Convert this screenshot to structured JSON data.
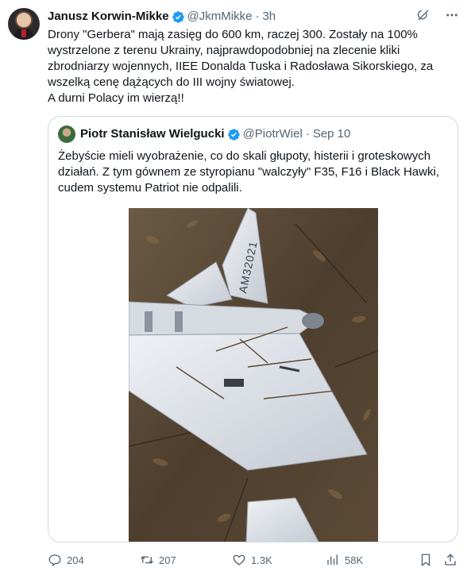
{
  "tweet": {
    "author_name": "Janusz Korwin-Mikke",
    "handle": "@JkmMikke",
    "separator": "·",
    "time": "3h",
    "text": "Drony \"Gerbera\" mają zasięg do 600 km, raczej 300. Zostały na 100% wystrzelone z terenu Ukrainy, najprawdopodobniej na zlecenie kliki zbrodniarzy wojennych, IIEE Donalda Tuska i Radosława Sikorskiego, za wszelką cenę dążących do III wojny światowej.\nA durni Polacy im wierzą!!"
  },
  "quoted": {
    "author_name": "Piotr Stanisław Wielgucki",
    "handle": "@PiotrWiel",
    "separator": "·",
    "time": "Sep 10",
    "text": "Żebyście mieli wyobrażenie, co do skali głupoty, histerii i groteskowych działań. Z tym gównem ze styropianu \"walczyły\" F35, F16 i Black Hawki, cudem systemu Patriot nie odpalili.",
    "image_marking": "AM32021"
  },
  "actions": {
    "replies": "204",
    "reposts": "207",
    "likes": "1.3K",
    "views": "58K"
  },
  "colors": {
    "accent": "#1d9bf0",
    "text_primary": "#0f1419",
    "text_secondary": "#536471",
    "border": "#cfd9de"
  },
  "icons": [
    "verified-badge-icon",
    "grok-icon",
    "more-icon",
    "reply-icon",
    "repost-icon",
    "like-icon",
    "views-icon",
    "bookmark-icon",
    "share-icon"
  ]
}
